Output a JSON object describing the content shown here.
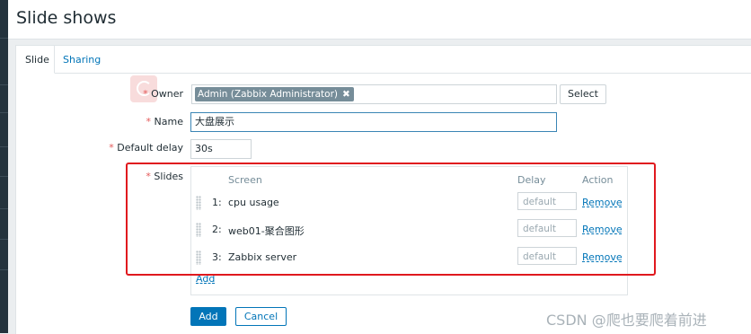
{
  "page": {
    "title": "Slide shows"
  },
  "tabs": [
    {
      "label": "Slide"
    },
    {
      "label": "Sharing"
    }
  ],
  "form": {
    "owner_label": "Owner",
    "owner_value": "Admin (Zabbix Administrator)",
    "owner_remove": "✖",
    "select_label": "Select",
    "name_label": "Name",
    "name_value": "大盘展示",
    "default_delay_label": "Default delay",
    "default_delay_value": "30s",
    "slides_label": "Slides",
    "required_mark": "*"
  },
  "slides": {
    "headers": {
      "screen": "Screen",
      "delay": "Delay",
      "action": "Action"
    },
    "rows": [
      {
        "num": "1:",
        "screen": "cpu usage",
        "delay_placeholder": "default",
        "action": "Remove"
      },
      {
        "num": "2:",
        "screen": "web01-聚合图形",
        "delay_placeholder": "default",
        "action": "Remove"
      },
      {
        "num": "3:",
        "screen": "Zabbix server",
        "delay_placeholder": "default",
        "action": "Remove"
      }
    ],
    "add_label": "Add"
  },
  "actions": {
    "add": "Add",
    "cancel": "Cancel"
  },
  "watermark": "CSDN @爬也要爬着前进",
  "colors": {
    "accent": "#0275b8",
    "required": "#e45959",
    "highlight_box": "#e0191e",
    "chip": "#768d99"
  },
  "icons": {
    "owner_remove": "close-icon",
    "drag": "drag-handle-icon"
  }
}
